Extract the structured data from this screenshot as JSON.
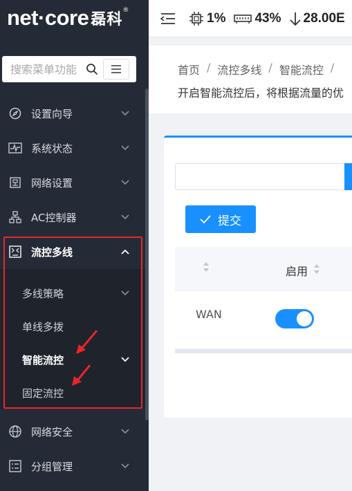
{
  "brand": {
    "name": "net·core",
    "name_cn": "磊科",
    "reg": "®"
  },
  "search": {
    "placeholder": "搜索菜单功能"
  },
  "sidebar": {
    "items": [
      {
        "label": "设置向导",
        "icon": "compass-icon"
      },
      {
        "label": "系统状态",
        "icon": "pulse-icon"
      },
      {
        "label": "网络设置",
        "icon": "network-icon"
      },
      {
        "label": "AC控制器",
        "icon": "ac-controller-icon"
      },
      {
        "label": "流控多线",
        "icon": "flow-control-icon",
        "active": true
      },
      {
        "label": "网络安全",
        "icon": "globe-icon"
      },
      {
        "label": "分组管理",
        "icon": "group-icon"
      }
    ],
    "sub_items": [
      {
        "label": "多线策略"
      },
      {
        "label": "单线多拨"
      },
      {
        "label": "智能流控"
      },
      {
        "label": "固定流控"
      }
    ]
  },
  "topbar": {
    "cpu": "1%",
    "memory": "43%",
    "download": "28.00E"
  },
  "breadcrumb": [
    "首页",
    "流控多线",
    "智能流控",
    ""
  ],
  "description": "开启智能流控后，将根据流量的优",
  "card": {
    "submit_label": "提交",
    "table": {
      "header_enable": "启用",
      "rows": [
        {
          "name": "WAN",
          "enabled": true
        }
      ]
    }
  },
  "colors": {
    "accent": "#1890ff",
    "sidebar_bg": "#252b36",
    "highlight": "#e8262a"
  }
}
